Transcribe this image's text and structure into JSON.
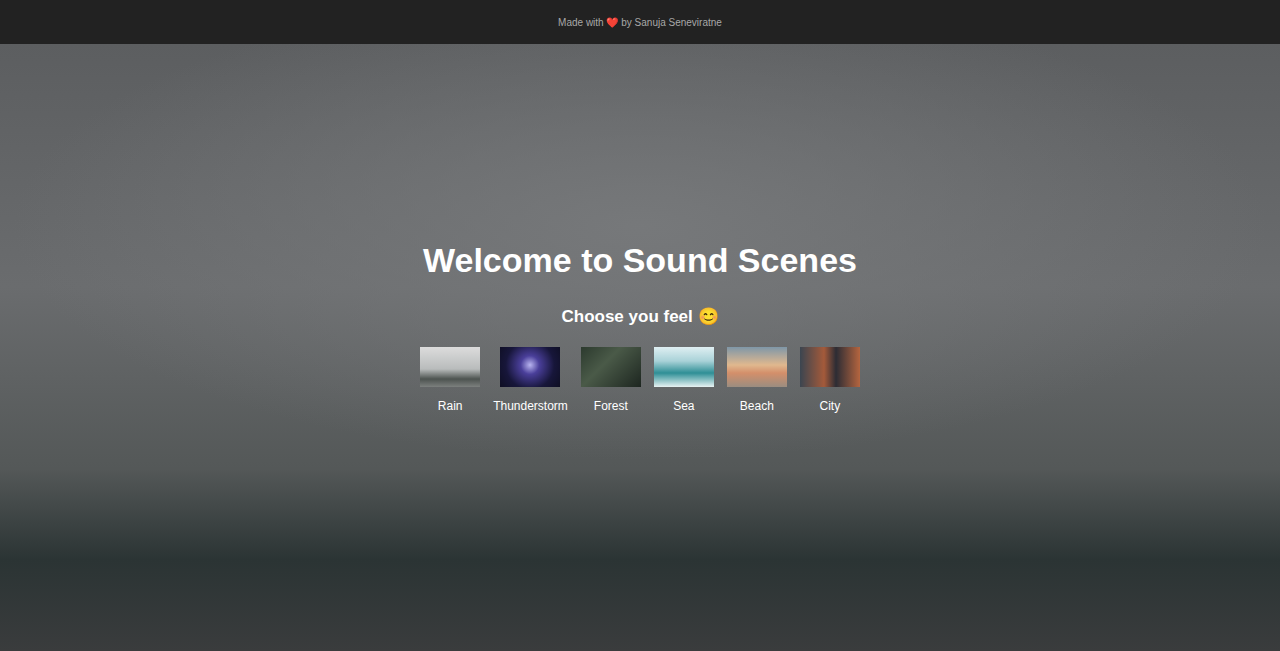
{
  "header": {
    "text": "Made with ❤️ by Sanuja Seneviratne"
  },
  "heading": "Welcome to Sound Scenes",
  "prompt": "Choose you feel 😊",
  "scenes": [
    {
      "label": "Rain"
    },
    {
      "label": "Thunderstorm"
    },
    {
      "label": "Forest"
    },
    {
      "label": "Sea"
    },
    {
      "label": "Beach"
    },
    {
      "label": "City"
    }
  ]
}
